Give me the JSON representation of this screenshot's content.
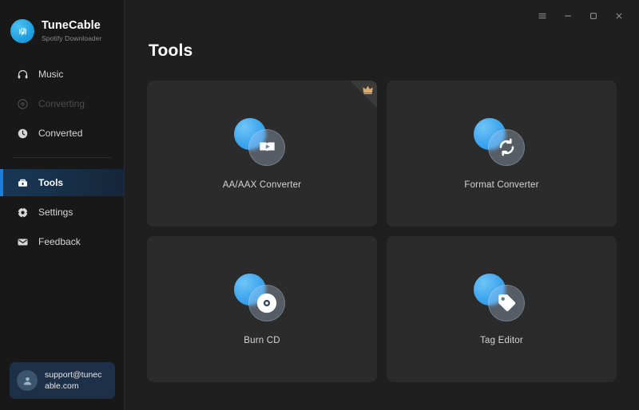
{
  "app": {
    "brand_name": "TuneCable",
    "brand_subtitle": "Spotify Downloader",
    "logo_icon": "music-waveform-icon",
    "colors": {
      "sidebar_bg": "#181818",
      "main_bg": "#1f1f1f",
      "card_bg": "#2b2b2b",
      "accent_blue": "#1b7fe0",
      "logo_blue": "#2c9fe0",
      "support_bg": "#1d3047",
      "badge_orange": "#e0a96a"
    }
  },
  "titlebar": {
    "buttons": [
      {
        "name": "menu-button",
        "icon": "hamburger-icon"
      },
      {
        "name": "minimize-button",
        "icon": "minimize-icon"
      },
      {
        "name": "maximize-button",
        "icon": "maximize-icon"
      },
      {
        "name": "close-button",
        "icon": "close-icon"
      }
    ]
  },
  "sidebar": {
    "items": [
      {
        "label": "Music",
        "icon": "headphones-icon",
        "state": "normal"
      },
      {
        "label": "Converting",
        "icon": "converting-disc-icon",
        "state": "disabled"
      },
      {
        "label": "Converted",
        "icon": "clock-icon",
        "state": "normal"
      },
      {
        "label": "Tools",
        "icon": "toolbox-icon",
        "state": "active"
      },
      {
        "label": "Settings",
        "icon": "gear-icon",
        "state": "normal"
      },
      {
        "label": "Feedback",
        "icon": "envelope-icon",
        "state": "normal"
      }
    ],
    "support": {
      "email_line1": "support@tunec",
      "email_line2": "able.com",
      "avatar_icon": "user-avatar-icon"
    }
  },
  "main": {
    "title": "Tools",
    "cards": [
      {
        "label": "AA/AAX Converter",
        "icon": "audiobook-play-icon",
        "badge": "crown-icon",
        "has_badge": true
      },
      {
        "label": "Format Converter",
        "icon": "refresh-sync-icon",
        "badge": "",
        "has_badge": false
      },
      {
        "label": "Burn CD",
        "icon": "compact-disc-icon",
        "badge": "",
        "has_badge": false
      },
      {
        "label": "Tag Editor",
        "icon": "price-tag-icon",
        "badge": "",
        "has_badge": false
      }
    ]
  }
}
